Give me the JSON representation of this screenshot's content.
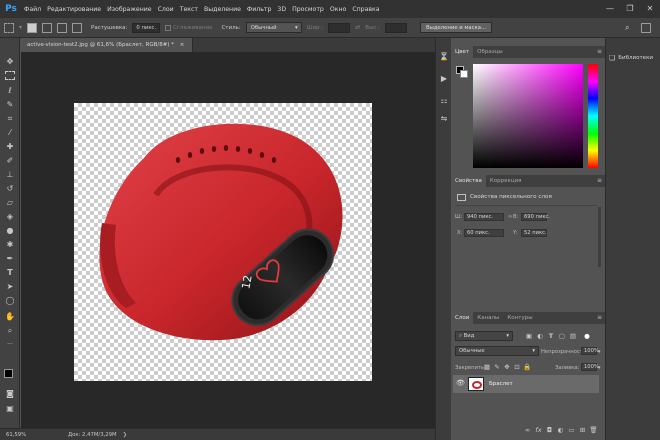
{
  "app": {
    "logo": "Ps"
  },
  "menu": [
    "Файл",
    "Редактирование",
    "Изображение",
    "Слои",
    "Текст",
    "Выделение",
    "Фильтр",
    "3D",
    "Просмотр",
    "Окно",
    "Справка"
  ],
  "window_controls": {
    "minimize": "—",
    "restore": "❐",
    "close": "✕"
  },
  "options_bar": {
    "feather_label": "Растушевка:",
    "feather_value": "0 пикс.",
    "antialias_label": "Сглаживание",
    "style_label": "Стиль:",
    "style_value": "Обычный",
    "width_label": "Шир.:",
    "height_label": "Выс.:",
    "select_mask_button": "Выделение и маска..."
  },
  "document": {
    "tab_title": "active-vision-test2.jpg @ 61,6% (Браслет, RGB/8#) *",
    "close_glyph": "×",
    "zoom": "61,59%",
    "doc_info": "Док: 2,47M/3,29M",
    "watch_display": "12"
  },
  "color_panel": {
    "tabs": [
      "Цвет",
      "Образцы"
    ],
    "menu_glyph": "≡"
  },
  "libraries_panel": {
    "label": "Библиотеки"
  },
  "properties_panel": {
    "tabs": [
      "Свойства",
      "Коррекция"
    ],
    "title": "Свойства пиксельного слоя",
    "w_label": "Ш:",
    "w_value": "940 пикс.",
    "link_glyph": "∞",
    "h_label": "В:",
    "h_value": "690 пикс.",
    "x_label": "X:",
    "x_value": "60 пикс.",
    "y_label": "Y:",
    "y_value": "52 пикс."
  },
  "layers_panel": {
    "tabs": [
      "Слои",
      "Каналы",
      "Контуры"
    ],
    "filter_kind": "Вид",
    "blend_mode": "Обычные",
    "opacity_label": "Непрозрачность:",
    "opacity_value": "100%",
    "lock_label": "Закрепить:",
    "fill_label": "Заливка:",
    "fill_value": "100%",
    "layers": [
      {
        "name": "Браслет",
        "visible": true
      }
    ]
  },
  "colors": {
    "accent": "#31a8ff",
    "strap": "#c8262b",
    "band_dark": "#1c1c1c",
    "hue_selected": "#ff00ff"
  }
}
